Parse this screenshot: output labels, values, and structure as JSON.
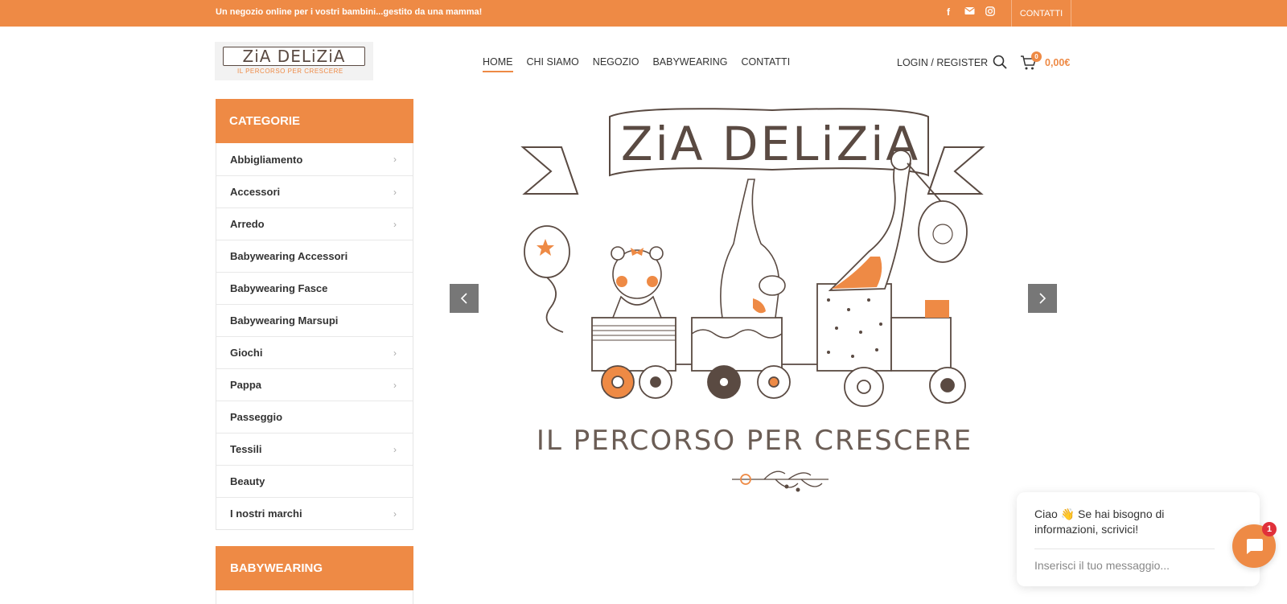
{
  "topbar": {
    "tagline": "Un negozio online per i vostri bambini...gestito da una mamma!",
    "icons": [
      "facebook-icon",
      "mail-icon",
      "instagram-icon"
    ],
    "contact_label": "CONTATTI"
  },
  "header": {
    "logo_text": "ZiA DELiZiA",
    "logo_subtext": "IL PERCORSO PER CRESCERE",
    "nav": [
      {
        "label": "HOME",
        "active": true
      },
      {
        "label": "CHI SIAMO",
        "active": false
      },
      {
        "label": "NEGOZIO",
        "active": false
      },
      {
        "label": "BABYWEARING",
        "active": false
      },
      {
        "label": "CONTATTI",
        "active": false
      }
    ],
    "login_label": "LOGIN / REGISTER",
    "cart_count": "0",
    "cart_total": "0,00€"
  },
  "sidebar": {
    "title": "CATEGORIE",
    "items": [
      {
        "label": "Abbigliamento",
        "has_sub": true
      },
      {
        "label": "Accessori",
        "has_sub": true
      },
      {
        "label": "Arredo",
        "has_sub": true
      },
      {
        "label": "Babywearing Accessori",
        "has_sub": false
      },
      {
        "label": "Babywearing Fasce",
        "has_sub": false
      },
      {
        "label": "Babywearing Marsupi",
        "has_sub": false
      },
      {
        "label": "Giochi",
        "has_sub": true
      },
      {
        "label": "Pappa",
        "has_sub": true
      },
      {
        "label": "Passeggio",
        "has_sub": false
      },
      {
        "label": "Tessili",
        "has_sub": true
      },
      {
        "label": "Beauty",
        "has_sub": false
      },
      {
        "label": "I nostri marchi",
        "has_sub": true
      }
    ],
    "second_title": "BABYWEARING"
  },
  "slider": {
    "banner_text": "ZiA DELiZiA",
    "tagline": "IL PERCORSO PER CRESCERE"
  },
  "chat": {
    "message": "Ciao 👋 Se hai bisogno di informazioni, scrivici!",
    "placeholder": "Inserisci il tuo messaggio...",
    "badge": "1"
  },
  "colors": {
    "accent": "#ee8a45",
    "dark": "#5a4a42"
  }
}
